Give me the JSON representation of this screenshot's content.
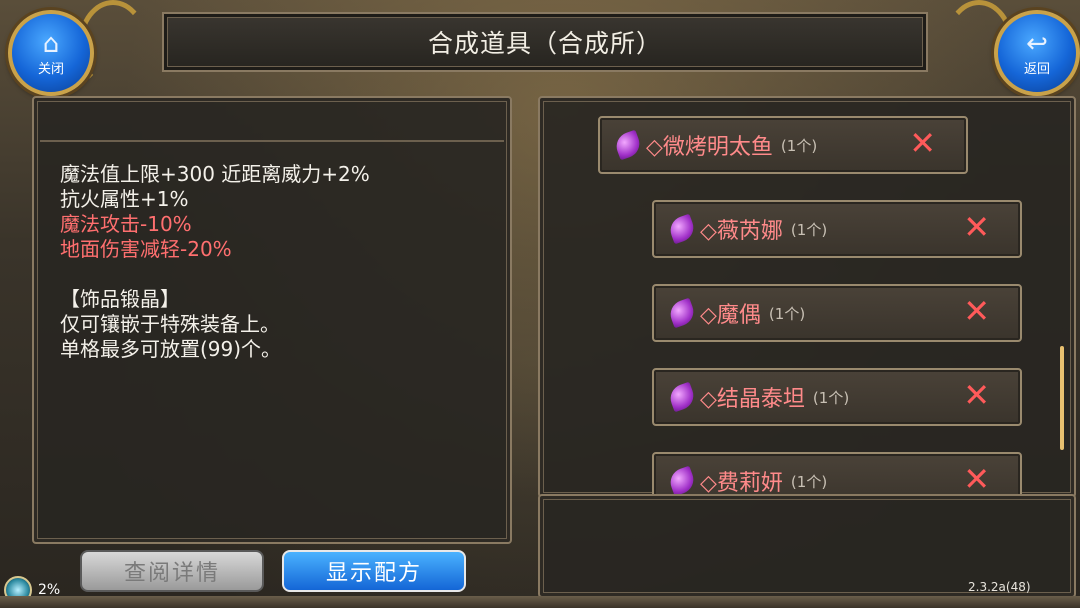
{
  "header": {
    "title": "合成道具（合成所）",
    "close_label": "关闭",
    "back_label": "返回"
  },
  "detail": {
    "lines": [
      "魔法值上限+300 近距离威力+2%",
      "抗火属性+1%"
    ],
    "red_lines": [
      "魔法攻击-10%",
      "地面伤害减轻-20%"
    ],
    "info_lines": [
      "【饰品锻晶】",
      "仅可镶嵌于特殊装备上。",
      "单格最多可放置(99)个。"
    ]
  },
  "buttons": {
    "view_details": "查阅详情",
    "show_recipe": "显示配方"
  },
  "items": [
    {
      "name": "◇微烤明太鱼",
      "count": "(1个)"
    },
    {
      "name": "◇薇芮娜",
      "count": "(1个)"
    },
    {
      "name": "◇魔偶",
      "count": "(1个)"
    },
    {
      "name": "◇结晶泰坦",
      "count": "(1个)"
    },
    {
      "name": "◇费莉妍",
      "count": "(1个)"
    }
  ],
  "status": {
    "percent": "2%",
    "version": "2.3.2a(48)"
  },
  "colors": {
    "red_text": "#ff6f6f",
    "item_name": "#ff8a8a",
    "accent_blue": "#1566d8",
    "frame_gold": "#c9a24a"
  },
  "icons": [
    "home-icon",
    "back-arrow-icon",
    "gem-icon",
    "remove-x-icon",
    "progress-ring-icon"
  ]
}
